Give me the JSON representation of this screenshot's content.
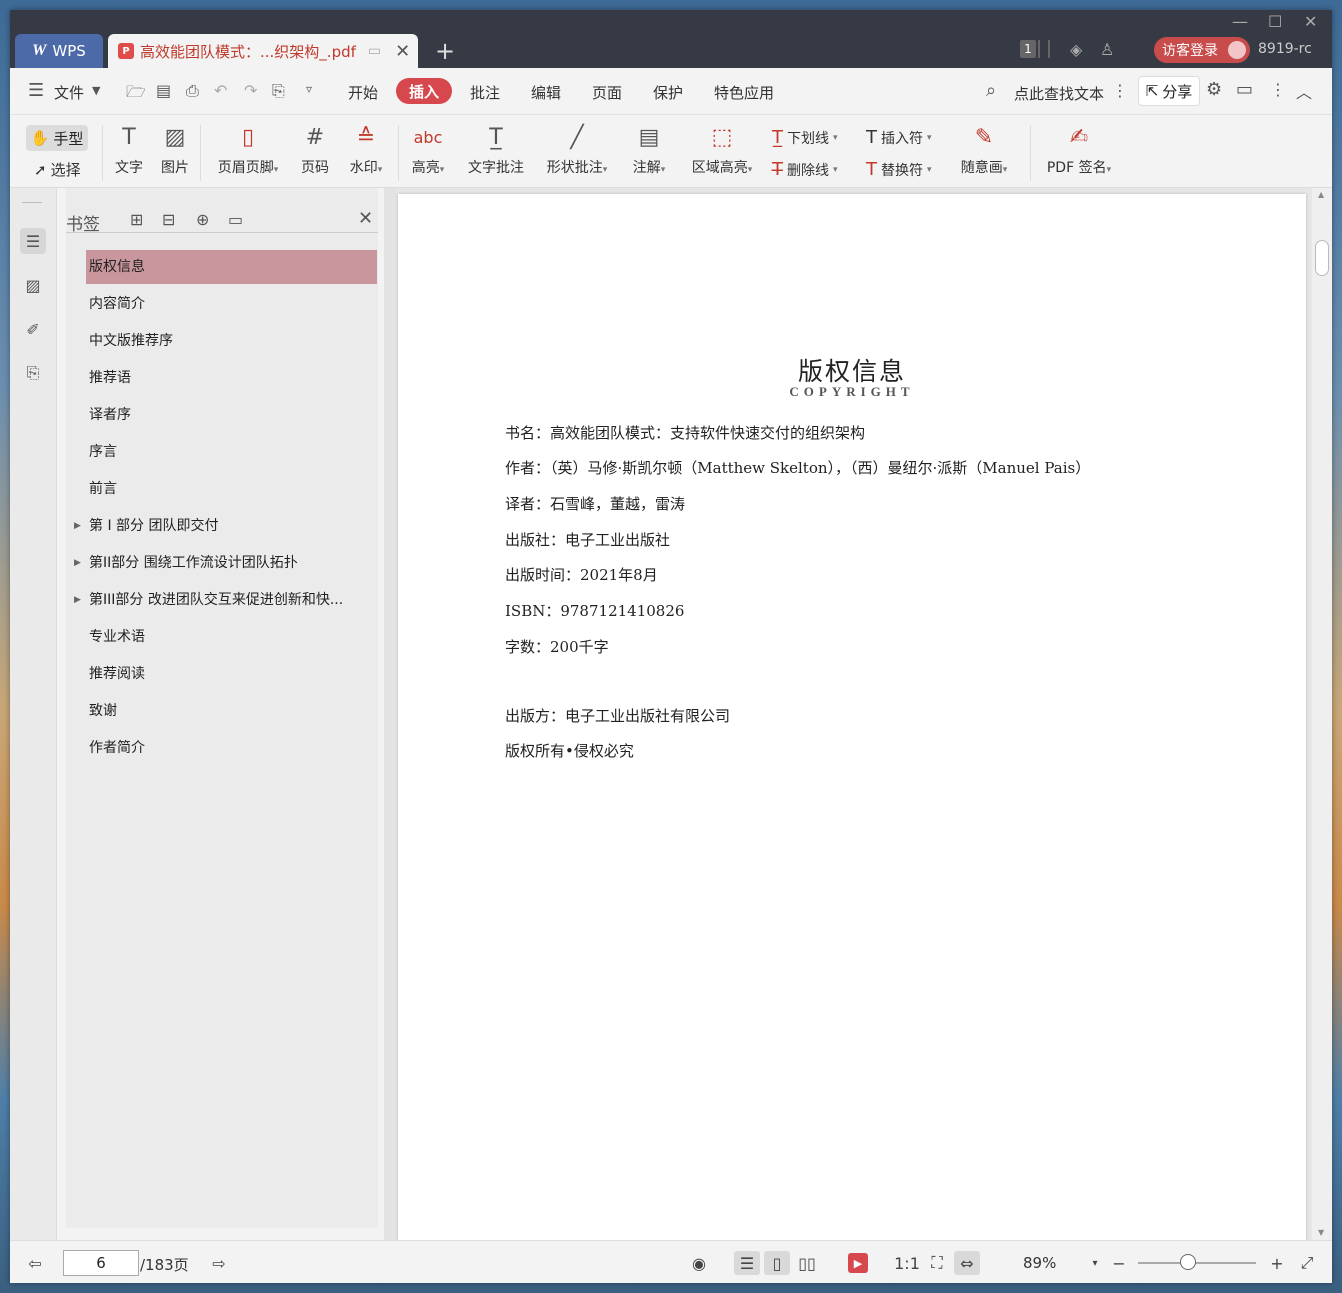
{
  "window": {
    "app_tab": "WPS",
    "doc_tab_title": "高效能团队模式：...织架构_.pdf",
    "new_tab_icon": "plus-icon",
    "badge_count": "1",
    "login_label": "访客登录",
    "user_id": "8919-rc"
  },
  "menu": {
    "file_label": "文件",
    "items": [
      "开始",
      "插入",
      "批注",
      "编辑",
      "页面",
      "保护",
      "特色应用"
    ],
    "active": "插入",
    "search_label": "点此查找文本",
    "share_label": "分享"
  },
  "ribbon": {
    "hand": "手型",
    "select": "选择",
    "text": "文字",
    "image": "图片",
    "header_footer": "页眉页脚",
    "page_number": "页码",
    "watermark": "水印",
    "highlight": "高亮",
    "text_comment": "文字批注",
    "shape_comment": "形状批注",
    "note": "注解",
    "area_highlight": "区域高亮",
    "underline": "下划线",
    "strikethrough": "删除线",
    "insert_mark": "插入符",
    "replace_mark": "替换符",
    "freehand": "随意画",
    "pdf_sign": "PDF 签名",
    "highlight_icon_text": "abc"
  },
  "bookmarks": {
    "title": "书签",
    "items": [
      {
        "label": "版权信息",
        "active": true,
        "expandable": false
      },
      {
        "label": "内容简介",
        "active": false,
        "expandable": false
      },
      {
        "label": "中文版推荐序",
        "active": false,
        "expandable": false
      },
      {
        "label": "推荐语",
        "active": false,
        "expandable": false
      },
      {
        "label": "译者序",
        "active": false,
        "expandable": false
      },
      {
        "label": "序言",
        "active": false,
        "expandable": false
      },
      {
        "label": "前言",
        "active": false,
        "expandable": false
      },
      {
        "label": "第 I 部分 团队即交付",
        "active": false,
        "expandable": true
      },
      {
        "label": "第II部分 围绕工作流设计团队拓扑",
        "active": false,
        "expandable": true
      },
      {
        "label": "第III部分 改进团队交互来促进创新和快...",
        "active": false,
        "expandable": true
      },
      {
        "label": "专业术语",
        "active": false,
        "expandable": false
      },
      {
        "label": "推荐阅读",
        "active": false,
        "expandable": false
      },
      {
        "label": "致谢",
        "active": false,
        "expandable": false
      },
      {
        "label": "作者简介",
        "active": false,
        "expandable": false
      }
    ]
  },
  "page": {
    "title": "版权信息",
    "subtitle": "COPYRIGHT",
    "lines": [
      "书名：高效能团队模式：支持软件快速交付的组织架构",
      "作者：（英）马修·斯凯尔顿（Matthew Skelton），（西）曼纽尔·派斯（Manuel Pais）",
      "译者：石雪峰，董越，雷涛",
      "出版社：电子工业出版社",
      "出版时间：2021年8月",
      "ISBN：9787121410826",
      "字数：200千字",
      "出版方：电子工业出版社有限公司",
      "版权所有•侵权必究"
    ]
  },
  "status": {
    "current_page": "6",
    "total_pages": "/183页",
    "zoom": "89%"
  },
  "colors": {
    "accent": "#d7484e",
    "titlebar": "#363a45",
    "bookmark_active": "#c9969d"
  }
}
